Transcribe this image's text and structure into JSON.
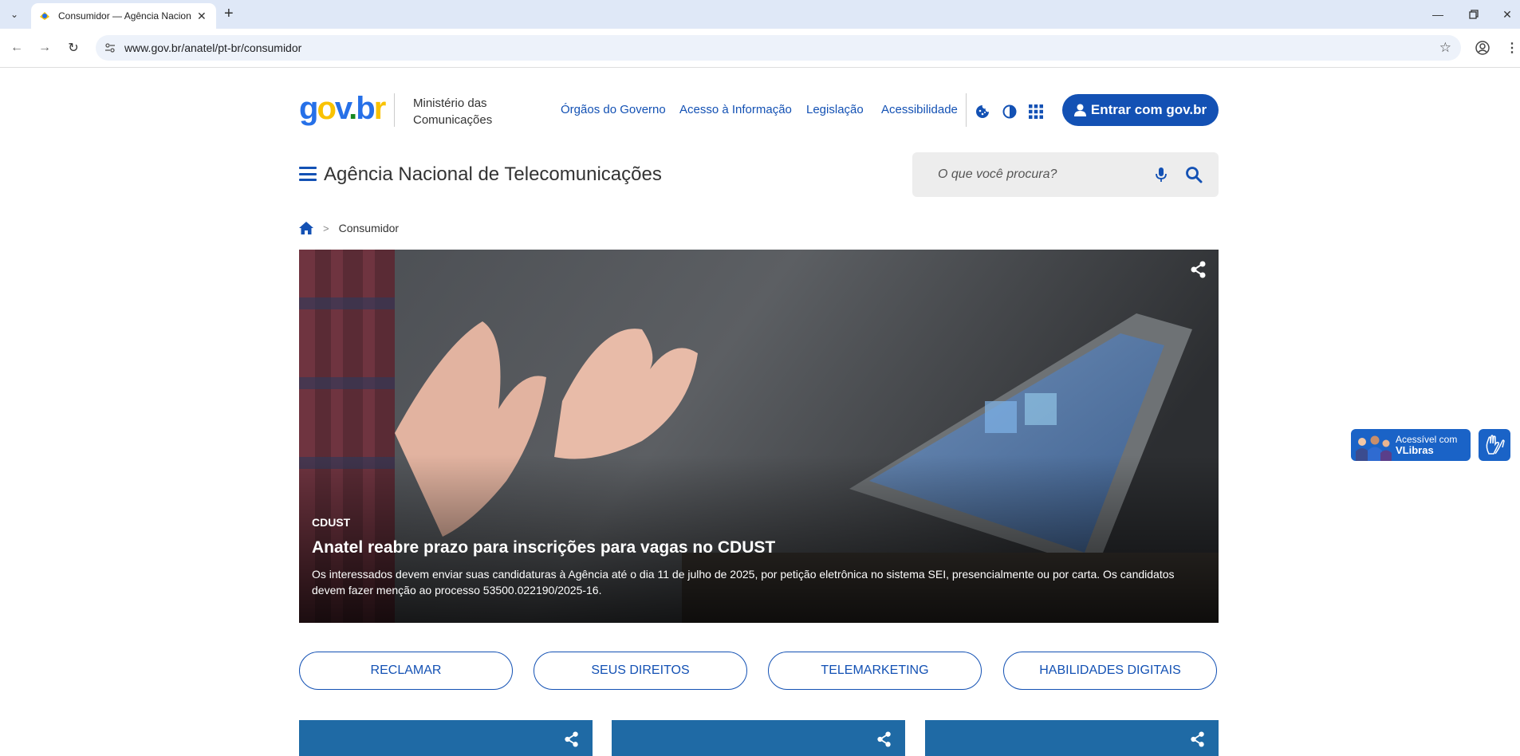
{
  "browser": {
    "tab_title": "Consumidor — Agência Nacion",
    "url": "www.gov.br/anatel/pt-br/consumidor"
  },
  "header": {
    "logo": {
      "g": "g",
      "o": "o",
      "v": "v",
      "dot": ".",
      "b": "b",
      "r": "r"
    },
    "ministry": "Ministério das Comunicações",
    "links": [
      "Órgãos do Governo",
      "Acesso à Informação",
      "Legislação",
      "Acessibilidade"
    ],
    "login_label": "Entrar com gov.br",
    "agency_title": "Agência Nacional de Telecomunicações",
    "search_placeholder": "O que você procura?"
  },
  "breadcrumb": {
    "separator": ">",
    "current": "Consumidor"
  },
  "hero": {
    "kicker": "CDUST",
    "headline": "Anatel reabre prazo para inscrições para vagas no CDUST",
    "description": "Os interessados devem enviar suas candidaturas à Agência até o dia 11 de julho de 2025, por petição eletrônica no sistema SEI, presencialmente ou por carta. Os candidatos devem fazer menção ao processo 53500.022190/2025-16."
  },
  "actions": [
    "RECLAMAR",
    "SEUS DIREITOS",
    "TELEMARKETING",
    "HABILIDADES DIGITAIS"
  ],
  "vlibras": {
    "line1": "Acessível com",
    "line2": "VLibras"
  },
  "colors": {
    "primary": "#1351b4",
    "card": "#1f6aa5",
    "vlibras": "#1a63c7"
  }
}
